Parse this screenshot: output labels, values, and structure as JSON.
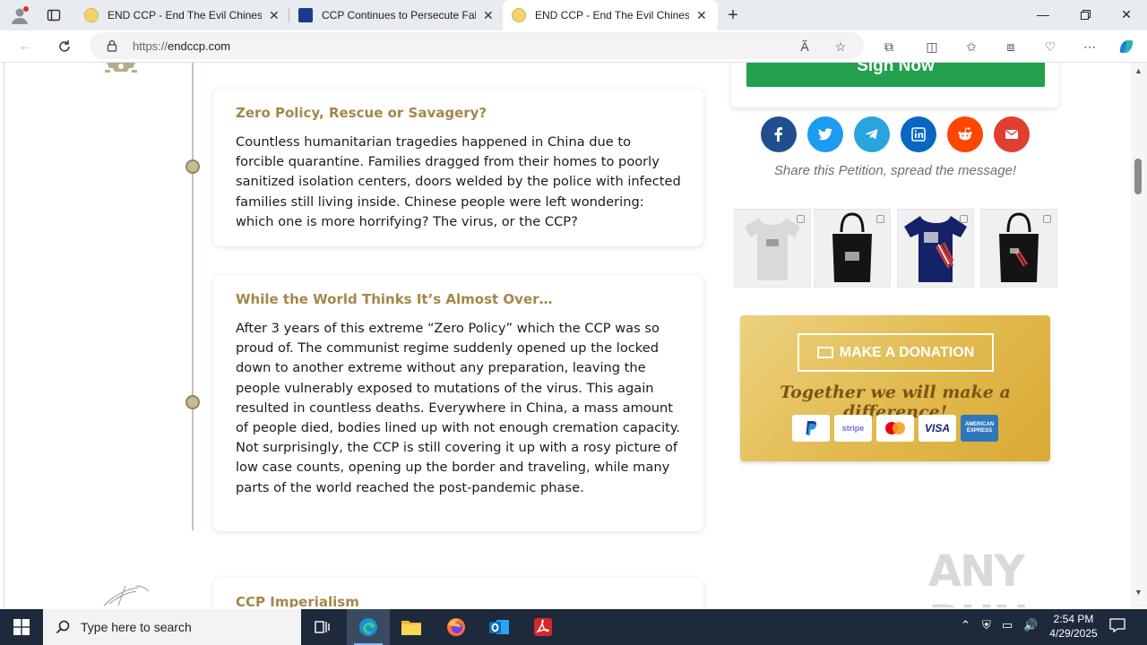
{
  "browser": {
    "tabs": [
      {
        "title": "END CCP - End The Evil Chinese",
        "favicon": "smiley-icon",
        "active": false
      },
      {
        "title": "CCP Continues to Persecute Falu",
        "favicon": "minghui-icon",
        "active": false
      },
      {
        "title": "END CCP - End The Evil Chinese",
        "favicon": "smiley-icon",
        "active": true
      }
    ],
    "new_tab": "+",
    "address": {
      "protocol": "https://",
      "host": "endccp.com"
    }
  },
  "timeline": {
    "cards": [
      {
        "title": "Zero Policy, Rescue or Savagery?",
        "body": "Countless humanitarian tragedies happened in China due to forcible quarantine. Families dragged from their homes to poorly sanitized isolation centers, doors welded by the police with infected families still living inside. Chinese people were left wondering: which one is more horrifying? The virus, or the CCP?"
      },
      {
        "title": "While the World Thinks It’s Almost Over…",
        "body": "After 3 years of this extreme “Zero Policy” which the CCP was so proud of. The communist regime suddenly opened up the locked down to another extreme without any preparation, leaving the people vulnerably exposed to mutations of the virus. This again resulted in countless deaths. Everywhere in China, a mass amount of people died, bodies lined up with not enough cremation capacity. Not surprisingly, the CCP is still covering it up with a rosy picture of low case counts, opening up the border and traveling, while many parts of the world reached the post-pandemic phase."
      },
      {
        "title": "CCP Imperialism",
        "body": ""
      }
    ]
  },
  "sidebar": {
    "sign_button": "Sign Now",
    "share_caption": "Share this Petition, spread the message!",
    "share_icons": [
      "facebook-icon",
      "twitter-icon",
      "telegram-icon",
      "linkedin-icon",
      "reddit-icon",
      "email-icon"
    ],
    "share_colors": [
      "#1f4f8f",
      "#1d9bf0",
      "#2aa4df",
      "#0a66c2",
      "#ff4500",
      "#e03e2f"
    ],
    "products": [
      "grey-tshirt",
      "black-tote",
      "navy-tshirt",
      "black-tote-2"
    ],
    "donation": {
      "button": "MAKE A DONATION",
      "tagline": "Together we will make a difference!",
      "payments": [
        "PayPal",
        "stripe",
        "mastercard",
        "VISA",
        "AMERICAN EXPRESS"
      ]
    }
  },
  "watermark": "ANY RUN",
  "taskbar": {
    "search_placeholder": "Type here to search",
    "time": "2:54 PM",
    "date": "4/29/2025"
  }
}
